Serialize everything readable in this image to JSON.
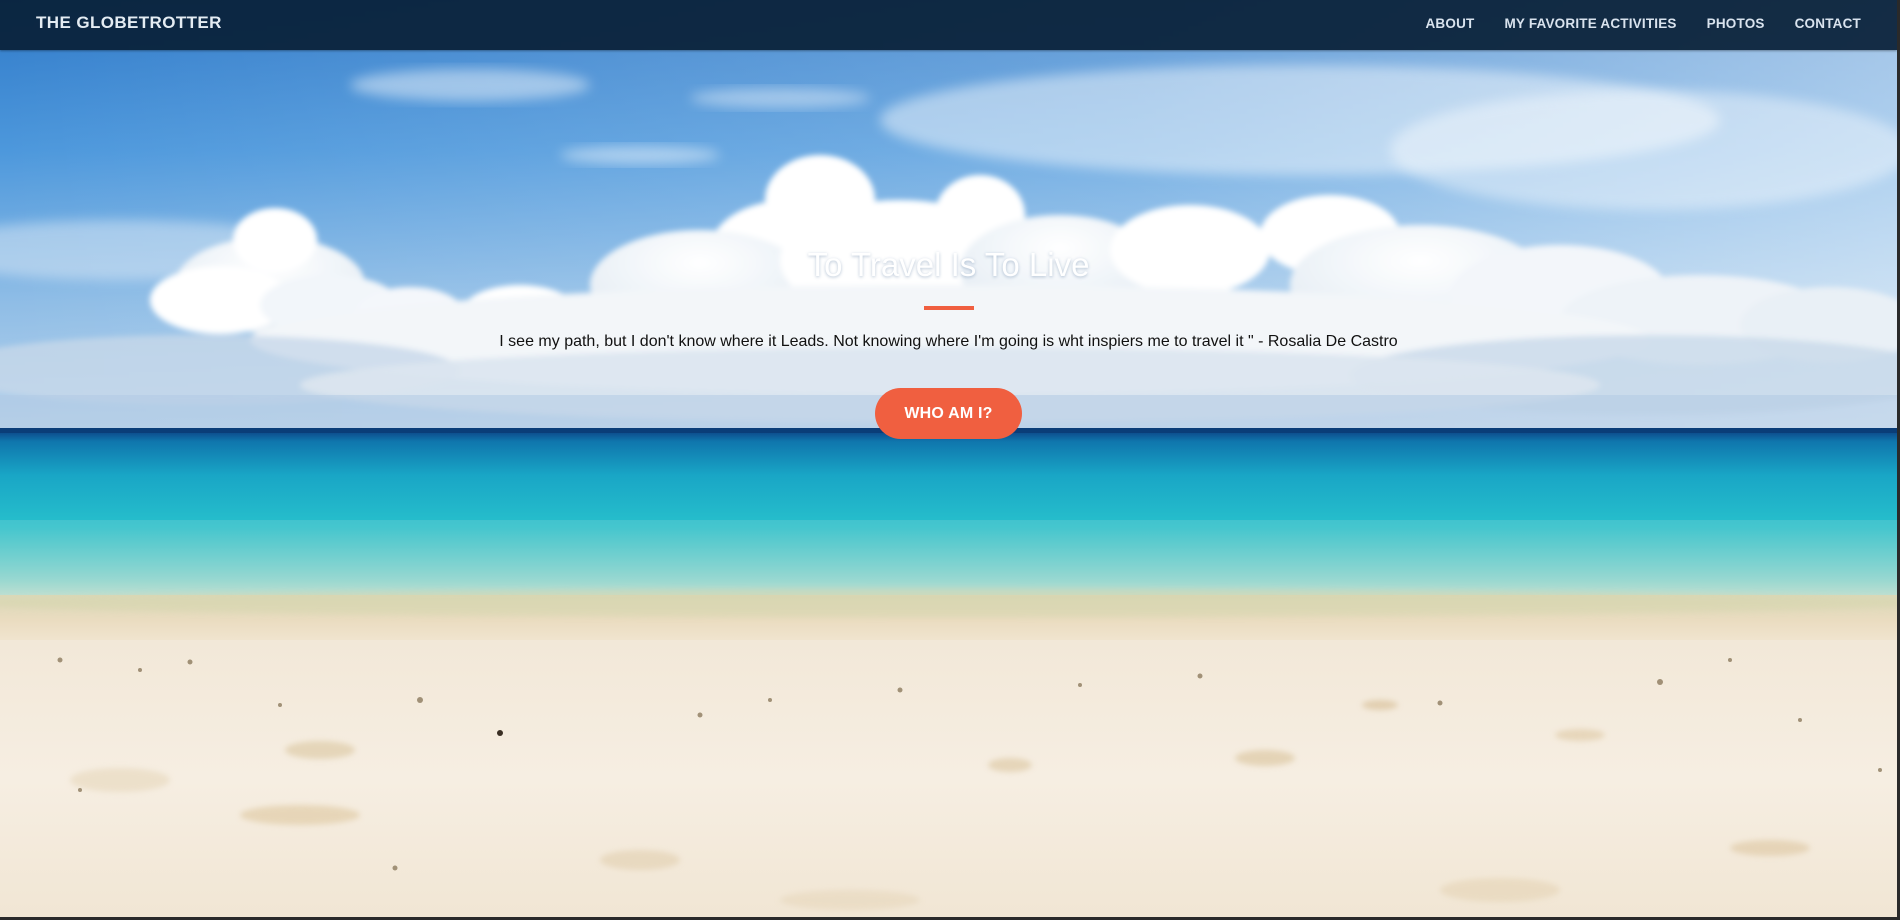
{
  "navbar": {
    "brand": "THE GLOBETROTTER",
    "links": [
      {
        "label": "ABOUT"
      },
      {
        "label": "MY FAVORITE ACTIVITIES"
      },
      {
        "label": "PHOTOS"
      },
      {
        "label": "CONTACT"
      }
    ]
  },
  "hero": {
    "title": "To Travel Is To Live",
    "quote": "I see my path, but I don't know where it Leads. Not knowing where I'm going is wht inspiers me to travel it \" - Rosalia De Castro",
    "button_label": "WHO AM I?",
    "background_image": "beach-ocean-sky-photo"
  },
  "colors": {
    "accent": "#f05f40",
    "navbar": "#0d2a47",
    "sky_top": "#2f7fcf",
    "sea": "#1fb1c4",
    "sand": "#f4ebdd"
  }
}
